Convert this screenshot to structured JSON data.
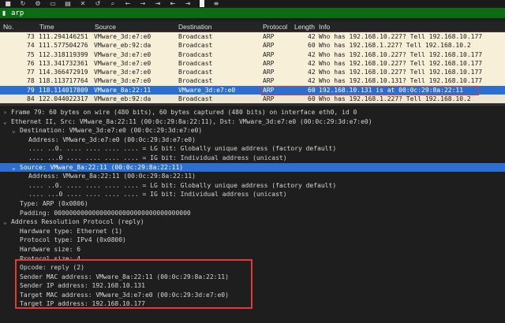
{
  "toolbar": {
    "icons": [
      "stop-icon",
      "restart-icon",
      "options-icon",
      "open-icon",
      "save-icon",
      "close-icon",
      "reload-icon",
      "search-icon",
      "back-icon",
      "forward-icon",
      "jump-icon",
      "first-icon",
      "last-icon",
      "autoscroll-icon",
      "colorize-icon"
    ]
  },
  "filter": {
    "value": "arp",
    "color": "#0d6b16"
  },
  "columns": {
    "no": "No.",
    "time": "Time",
    "source": "Source",
    "destination": "Destination",
    "protocol": "Protocol",
    "length": "Length",
    "info": "Info"
  },
  "packets": [
    {
      "no": "73",
      "time": "111.294146251",
      "source": "VMware_3d:e7:e0",
      "destination": "Broadcast",
      "protocol": "ARP",
      "length": "42",
      "info": "Who has 192.168.10.227? Tell 192.168.10.177"
    },
    {
      "no": "74",
      "time": "111.577504276",
      "source": "VMware_eb:92:da",
      "destination": "Broadcast",
      "protocol": "ARP",
      "length": "60",
      "info": "Who has 192.168.1.227? Tell 192.168.10.2"
    },
    {
      "no": "75",
      "time": "112.318119399",
      "source": "VMware_3d:e7:e0",
      "destination": "Broadcast",
      "protocol": "ARP",
      "length": "42",
      "info": "Who has 192.168.10.227? Tell 192.168.10.177"
    },
    {
      "no": "76",
      "time": "113.341732361",
      "source": "VMware_3d:e7:e0",
      "destination": "Broadcast",
      "protocol": "ARP",
      "length": "42",
      "info": "Who has 192.168.10.227? Tell 192.168.10.177"
    },
    {
      "no": "77",
      "time": "114.366472919",
      "source": "VMware_3d:e7:e0",
      "destination": "Broadcast",
      "protocol": "ARP",
      "length": "42",
      "info": "Who has 192.168.10.227? Tell 192.168.10.177"
    },
    {
      "no": "78",
      "time": "118.113717764",
      "source": "VMware_3d:e7:e0",
      "destination": "Broadcast",
      "protocol": "ARP",
      "length": "42",
      "info": "Who has 192.168.10.131? Tell 192.168.10.177"
    },
    {
      "no": "79",
      "time": "118.114017809",
      "source": "VMware_8a:22:11",
      "destination": "VMware_3d:e7:e0",
      "protocol": "ARP",
      "length": "60",
      "info": "192.168.10.131 is at 00:0c:29:8a:22:11"
    },
    {
      "no": "84",
      "time": "122.044022317",
      "source": "VMware_eb:92:da",
      "destination": "Broadcast",
      "protocol": "ARP",
      "length": "60",
      "info": "Who has 192.168.1.227? Tell 192.168.10.2"
    }
  ],
  "details": [
    {
      "toggle": "›",
      "text": "Frame 79: 60 bytes on wire (480 bits), 60 bytes captured (480 bits) on interface eth0, id 0"
    },
    {
      "toggle": "⌄",
      "text": "Ethernet II, Src: VMware_8a:22:11 (00:0c:29:8a:22:11), Dst: VMware_3d:e7:e0 (00:0c:29:3d:e7:e0)"
    },
    {
      "toggle": "⌄",
      "text": "Destination: VMware_3d:e7:e0 (00:0c:29:3d:e7:e0)"
    },
    {
      "toggle": "",
      "text": "Address: VMware_3d:e7:e0 (00:0c:29:3d:e7:e0)"
    },
    {
      "toggle": "",
      "text": ".... ..0. .... .... .... .... = LG bit: Globally unique address (factory default)"
    },
    {
      "toggle": "",
      "text": ".... ...0 .... .... .... .... = IG bit: Individual address (unicast)"
    },
    {
      "toggle": "⌄",
      "text": "Source: VMware_8a:22:11 (00:0c:29:8a:22:11)"
    },
    {
      "toggle": "",
      "text": "Address: VMware_8a:22:11 (00:0c:29:8a:22:11)"
    },
    {
      "toggle": "",
      "text": ".... ..0. .... .... .... .... = LG bit: Globally unique address (factory default)"
    },
    {
      "toggle": "",
      "text": ".... ...0 .... .... .... .... = IG bit: Individual address (unicast)"
    },
    {
      "toggle": "",
      "text": "Type: ARP (0x0806)"
    },
    {
      "toggle": "",
      "text": "Padding: 000000000000000000000000000000000000"
    },
    {
      "toggle": "⌄",
      "text": "Address Resolution Protocol (reply)"
    },
    {
      "toggle": "",
      "text": "Hardware type: Ethernet (1)"
    },
    {
      "toggle": "",
      "text": "Protocol type: IPv4 (0x0800)"
    },
    {
      "toggle": "",
      "text": "Hardware size: 6"
    },
    {
      "toggle": "",
      "text": "Protocol size: 4"
    },
    {
      "toggle": "",
      "text": "Opcode: reply (2)"
    },
    {
      "toggle": "",
      "text": "Sender MAC address: VMware_8a:22:11 (00:0c:29:8a:22:11)"
    },
    {
      "toggle": "",
      "text": "Sender IP address: 192.168.10.131"
    },
    {
      "toggle": "",
      "text": "Target MAC address: VMware_3d:e7:e0 (00:0c:29:3d:e7:e0)"
    },
    {
      "toggle": "",
      "text": "Target IP address: 192.168.10.177"
    }
  ],
  "colors": {
    "arp_row": "#f8efd8",
    "selected_row": "#2c6fd1",
    "highlight_box": "#e53935"
  }
}
